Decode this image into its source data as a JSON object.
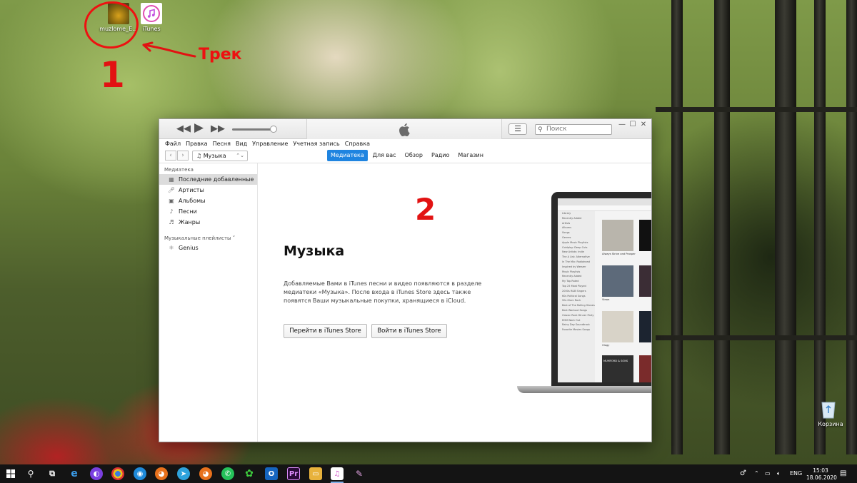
{
  "desktop": {
    "icons": [
      {
        "label": "muzlome_E...",
        "icon": "music-track-file-icon"
      },
      {
        "label": "iTunes",
        "icon": "itunes-icon"
      },
      {
        "label": "Корзина",
        "icon": "recycle-bin-icon"
      }
    ],
    "annotations": {
      "track_label": "Трек",
      "number_1": "1",
      "number_2": "2",
      "color": "#e21212"
    }
  },
  "itunes": {
    "search_placeholder": "Поиск",
    "menu": [
      "Файл",
      "Правка",
      "Песня",
      "Вид",
      "Управление",
      "Учетная запись",
      "Справка"
    ],
    "media_select": "Музыка",
    "tabs": [
      {
        "label": "Медиатека",
        "active": true
      },
      {
        "label": "Для вас",
        "active": false
      },
      {
        "label": "Обзор",
        "active": false
      },
      {
        "label": "Радио",
        "active": false
      },
      {
        "label": "Магазин",
        "active": false
      }
    ],
    "sidebar": {
      "library_header": "Медиатека",
      "library_items": [
        {
          "label": "Последние добавленные",
          "icon": "grid-icon",
          "selected": true
        },
        {
          "label": "Артисты",
          "icon": "microphone-icon",
          "selected": false
        },
        {
          "label": "Альбомы",
          "icon": "album-icon",
          "selected": false
        },
        {
          "label": "Песни",
          "icon": "note-icon",
          "selected": false
        },
        {
          "label": "Жанры",
          "icon": "genres-icon",
          "selected": false
        }
      ],
      "playlists_header": "Музыкальные плейлисты ˅",
      "playlist_items": [
        {
          "label": "Genius",
          "icon": "genius-icon"
        }
      ]
    },
    "main": {
      "title": "Музыка",
      "description": "Добавляемые Вами в iTunes песни и видео появляются в разделе медиатеки «Музыка». После входа в iTunes Store здесь также появятся Ваши музыкальные покупки, хранящиеся в iCloud.",
      "goto_store_button": "Перейти в iTunes Store",
      "signin_button": "Войти в iTunes Store"
    },
    "illustration": {
      "sidebar_lines": [
        "Library",
        "Recently Added",
        "Artists",
        "Albums",
        "Songs",
        "Genres",
        "Apple Music Playlists",
        "Coldplay: Deep Cuts",
        "New Artists: Indie",
        "The A List: Alternative",
        "In The Mix: Radiohead",
        "Inspired by Weezer",
        "Music Playlists",
        "Recently Added",
        "My Top Rated",
        "Top 25 Most Played",
        "2000s R&B Singers",
        "60s Political Songs",
        "90s Glam Rock",
        "Best of The Rolling Stones",
        "Best Workout Songs",
        "Classic Rock Dinner Party",
        "EDM Work Out",
        "Rainy Day Soundtrack",
        "Favorite Movies Songs"
      ],
      "albums": [
        {
          "caption": "Always Strive and Prosper",
          "color": "#b9b5ac"
        },
        {
          "caption": "Views",
          "color": "#5d6a7a"
        },
        {
          "caption": "Ology",
          "color": "#d8d3c8"
        },
        {
          "caption": "MUMFORD & SONS",
          "color": "#2f2f2f"
        }
      ]
    }
  },
  "taskbar": {
    "language": "ENG",
    "time": "15:03",
    "date": "18.06.2020"
  }
}
